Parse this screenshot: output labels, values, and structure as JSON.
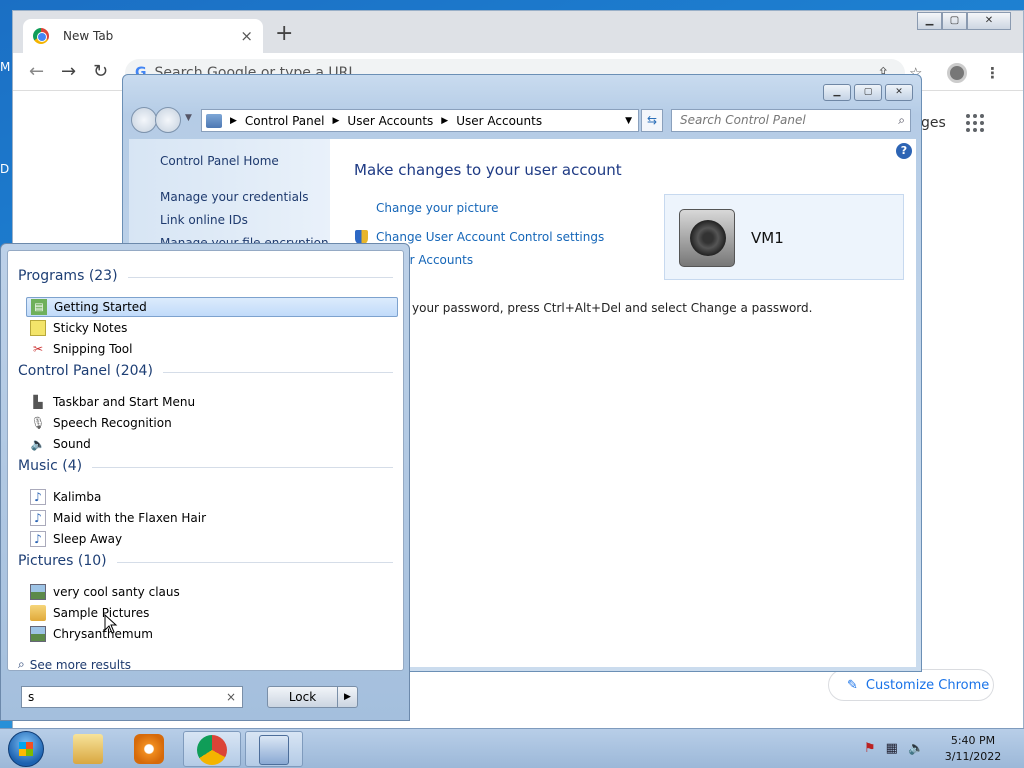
{
  "desktop": {
    "frag_top": "M",
    "frag_mid": "D"
  },
  "chrome": {
    "tab_title": "New Tab",
    "tab_close": "×",
    "new_tab": "+",
    "omnibox_placeholder": "Search Google or type a URL",
    "right_fragment": "ges",
    "customize_label": "Customize Chrome",
    "window_buttons": {
      "minimize": "▁",
      "maximize": "▢",
      "close": "✕"
    }
  },
  "control_panel": {
    "breadcrumb": [
      "Control Panel",
      "User Accounts",
      "User Accounts"
    ],
    "search_placeholder": "Search Control Panel",
    "sidebar": [
      "Control Panel Home",
      "Manage your credentials",
      "Link online IDs",
      "Manage your file encryption"
    ],
    "heading": "Make changes to your user account",
    "links": {
      "change_picture": "Change your picture",
      "uac": "Change User Account Control settings",
      "manage_accounts": "e User Accounts"
    },
    "password_text": "your password, press Ctrl+Alt+Del and select Change a password.",
    "username": "VM1",
    "help": "?"
  },
  "start_menu": {
    "groups": [
      {
        "title": "Programs (23)",
        "items": [
          {
            "label": "Getting Started",
            "icon": "getting-started-icon",
            "selected": true
          },
          {
            "label": "Sticky Notes",
            "icon": "sticky-notes-icon"
          },
          {
            "label": "Snipping Tool",
            "icon": "scissors-icon"
          }
        ]
      },
      {
        "title": "Control Panel (204)",
        "items": [
          {
            "label": "Taskbar and Start Menu",
            "icon": "taskbar-icon"
          },
          {
            "label": "Speech Recognition",
            "icon": "microphone-icon"
          },
          {
            "label": "Sound",
            "icon": "speaker-icon"
          }
        ]
      },
      {
        "title": "Music (4)",
        "items": [
          {
            "label": "Kalimba",
            "icon": "music-file-icon"
          },
          {
            "label": "Maid with the Flaxen Hair",
            "icon": "music-file-icon"
          },
          {
            "label": "Sleep Away",
            "icon": "music-file-icon"
          }
        ]
      },
      {
        "title": "Pictures (10)",
        "items": [
          {
            "label": "very cool santy claus",
            "icon": "image-file-icon"
          },
          {
            "label": "Sample Pictures",
            "icon": "folder-icon"
          },
          {
            "label": "Chrysanthemum",
            "icon": "image-file-icon"
          }
        ]
      }
    ],
    "see_more": "See more results",
    "search_value": "s",
    "clear": "×",
    "lock_label": "Lock"
  },
  "taskbar": {
    "time": "5:40 PM",
    "date": "3/11/2022",
    "pinned": [
      "windows-explorer-icon",
      "media-player-icon",
      "chrome-icon",
      "control-panel-icon"
    ]
  }
}
